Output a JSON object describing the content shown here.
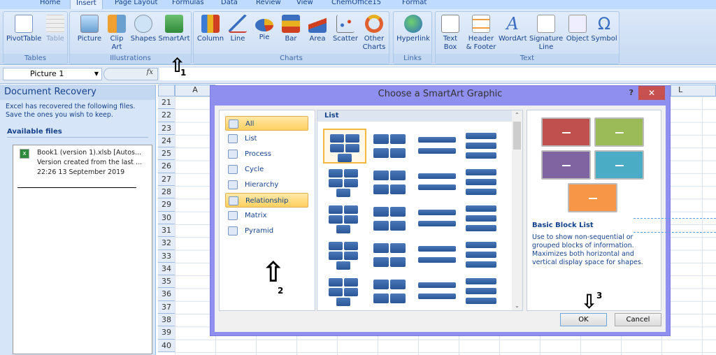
{
  "ribbon": {
    "tabs": [
      "Home",
      "Insert",
      "Page Layout",
      "Formulas",
      "Data",
      "Review",
      "View",
      "ChemOffice15",
      "Format"
    ],
    "active_tab": "Insert",
    "groups": [
      {
        "label": "Tables",
        "buttons": [
          "PivotTable",
          "Table"
        ]
      },
      {
        "label": "Illustrations",
        "buttons": [
          "Picture",
          "Clip Art",
          "Shapes",
          "SmartArt"
        ]
      },
      {
        "label": "Charts",
        "buttons": [
          "Column",
          "Line",
          "Pie",
          "Bar",
          "Area",
          "Scatter",
          "Other Charts"
        ]
      },
      {
        "label": "Links",
        "buttons": [
          "Hyperlink"
        ]
      },
      {
        "label": "Text",
        "buttons": [
          "Text Box",
          "Header & Footer",
          "WordArt",
          "Signature Line",
          "Object",
          "Symbol"
        ]
      }
    ]
  },
  "formula_bar": {
    "name_box": "Picture 1",
    "fx": "fx",
    "value": ""
  },
  "recovery": {
    "title": "Document Recovery",
    "message": "Excel has recovered the following files.  Save the ones you wish to keep.",
    "section": "Available files",
    "file": {
      "name": "Book1 (version 1).xlsb  [Autos...",
      "desc": "Version created from the last ...",
      "time": "22:26 13 September 2019"
    }
  },
  "sheet": {
    "columns": [
      "A",
      "L"
    ],
    "rows": [
      "21",
      "22",
      "23",
      "24",
      "25",
      "26",
      "27",
      "28",
      "29",
      "30",
      "31",
      "32",
      "33",
      "34",
      "35",
      "36",
      "37",
      "38",
      "39",
      "40"
    ]
  },
  "dialog": {
    "title": "Choose a SmartArt Graphic",
    "help": "?",
    "close": "✕",
    "categories": [
      "All",
      "List",
      "Process",
      "Cycle",
      "Hierarchy",
      "Relationship",
      "Matrix",
      "Pyramid"
    ],
    "selected_category": "All",
    "highlighted_category": "Relationship",
    "gallery_header": "List",
    "preview": {
      "title": "Basic Block List",
      "description": "Use to show non-sequential or grouped blocks of information. Maximizes both horizontal and vertical display space for shapes.",
      "colors": [
        "#c0504d",
        "#9bbb59",
        "#8064a2",
        "#4bacc6",
        "#f79646"
      ]
    },
    "ok": "OK",
    "cancel": "Cancel"
  },
  "annotations": [
    "1",
    "2",
    "3"
  ]
}
